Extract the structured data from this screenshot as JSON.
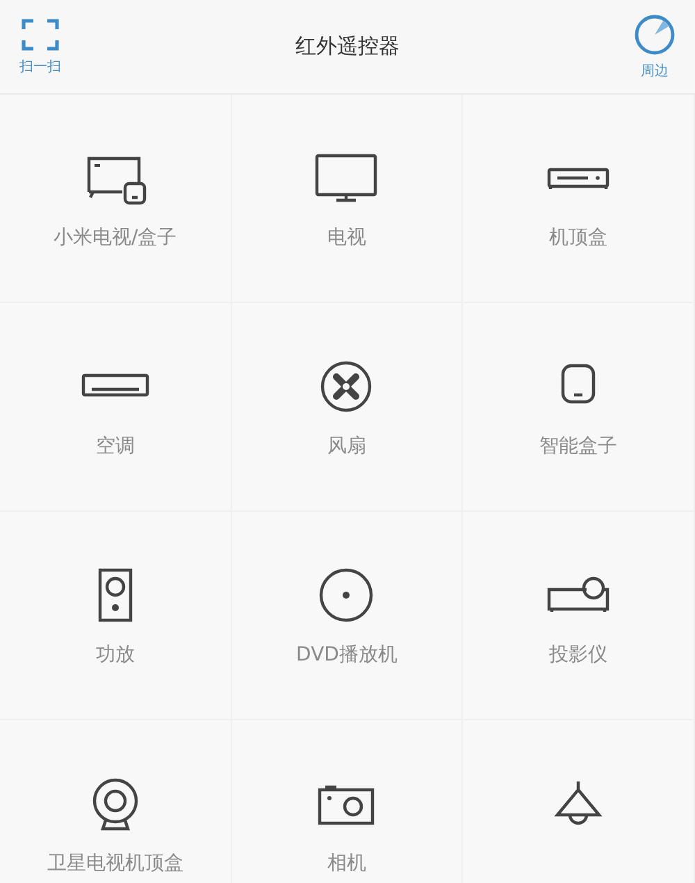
{
  "header": {
    "scan": {
      "label": "扫一扫"
    },
    "title": "红外遥控器",
    "nearby": {
      "label": "周边"
    }
  },
  "devices": [
    {
      "kind": "mitv",
      "label": "小米电视/盒子"
    },
    {
      "kind": "tv",
      "label": "电视"
    },
    {
      "kind": "settopbox",
      "label": "机顶盒"
    },
    {
      "kind": "aircon",
      "label": "空调"
    },
    {
      "kind": "fan",
      "label": "风扇"
    },
    {
      "kind": "smartbox",
      "label": "智能盒子"
    },
    {
      "kind": "speaker",
      "label": "功放"
    },
    {
      "kind": "disc",
      "label": "DVD播放机"
    },
    {
      "kind": "projector",
      "label": "投影仪"
    },
    {
      "kind": "satellite",
      "label": "卫星电视机顶盒"
    },
    {
      "kind": "camera",
      "label": "相机"
    },
    {
      "kind": "lamp"
    }
  ]
}
